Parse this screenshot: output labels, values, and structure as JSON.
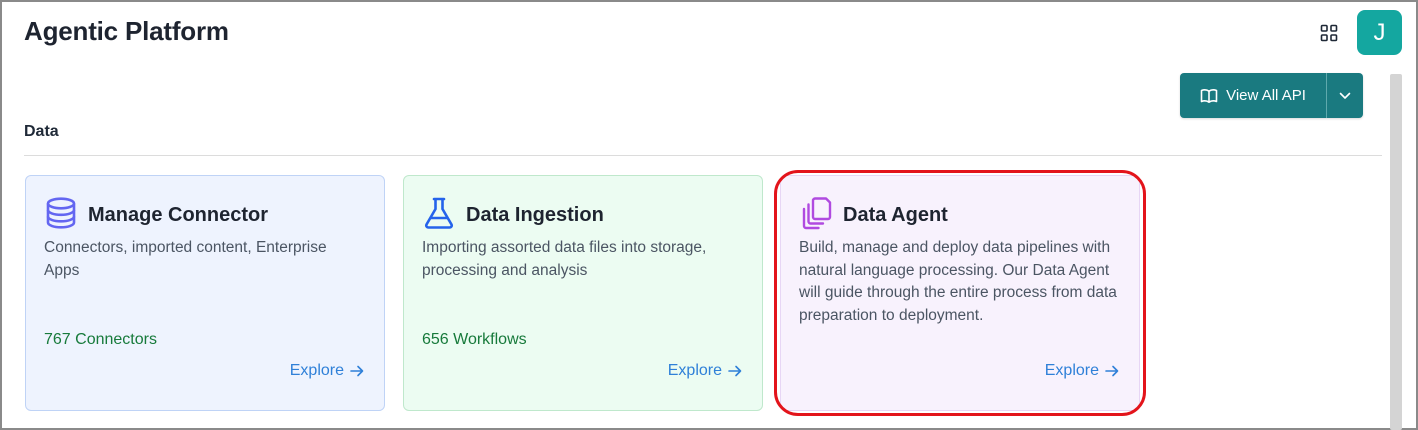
{
  "app": {
    "title": "Agentic Platform",
    "avatar_initial": "J"
  },
  "toolbar": {
    "view_all_api_label": "View All API"
  },
  "section": {
    "title": "Data"
  },
  "cards": [
    {
      "title": "Manage Connector",
      "description": "Connectors, imported content, Enterprise Apps",
      "count": "767 Connectors",
      "explore": "Explore",
      "icon": "database-icon",
      "icon_color": "#6366f1"
    },
    {
      "title": "Data Ingestion",
      "description": "Importing assorted data files into storage, processing and analysis",
      "count": "656 Workflows",
      "explore": "Explore",
      "icon": "flask-icon",
      "icon_color": "#2563eb"
    },
    {
      "title": "Data Agent",
      "description": "Build, manage and deploy data pipelines with natural language processing. Our Data Agent will guide through the entire process from data preparation to deployment.",
      "explore": "Explore",
      "icon": "copy-icon",
      "icon_color": "#b04ae0"
    }
  ],
  "colors": {
    "accent": "#1a7a80",
    "avatar": "#14a7a0",
    "link": "#2f80d8",
    "count": "#177a3b",
    "highlight": "#e3141b"
  }
}
